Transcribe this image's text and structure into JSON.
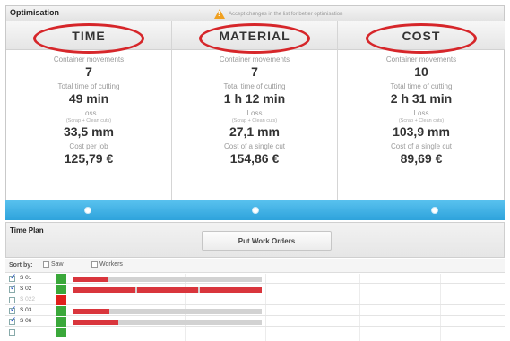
{
  "header": {
    "title": "Optimisation",
    "warning_text": "Accept changes in the list for better optimisation"
  },
  "columns": [
    {
      "title": "TIME",
      "metrics": [
        {
          "label": "Container movements",
          "value": "7"
        },
        {
          "label": "Total time of cutting",
          "value": "49 min"
        },
        {
          "label": "Loss",
          "sublabel": "(Scrap + Clean cuts)",
          "value": "33,5 mm"
        },
        {
          "label": "Cost per job",
          "value": "125,79 €"
        }
      ]
    },
    {
      "title": "MATERIAL",
      "metrics": [
        {
          "label": "Container movements",
          "value": "7"
        },
        {
          "label": "Total time of cutting",
          "value": "1 h 12 min"
        },
        {
          "label": "Loss",
          "sublabel": "(Scrap + Clean cuts)",
          "value": "27,1 mm"
        },
        {
          "label": "Cost of a single cut",
          "value": "154,86 €"
        }
      ]
    },
    {
      "title": "COST",
      "metrics": [
        {
          "label": "Container movements",
          "value": "10"
        },
        {
          "label": "Total time of cutting",
          "value": "2 h 31 min"
        },
        {
          "label": "Loss",
          "sublabel": "(Scrap + Clean cuts)",
          "value": "103,9 mm"
        },
        {
          "label": "Cost of a single cut",
          "value": "89,69 €"
        }
      ]
    }
  ],
  "time_plan": {
    "title": "Time Plan",
    "button_label": "Put Work Orders",
    "sort_by_label": "Sort by:",
    "sort_options": [
      "Saw",
      "Workers"
    ]
  },
  "rows": [
    {
      "label": "S 01",
      "checked": true,
      "status": "green",
      "bars": [
        [
          0.0,
          0.18
        ]
      ],
      "track_end": 1.0
    },
    {
      "label": "S 02",
      "checked": true,
      "status": "green",
      "bars": [
        [
          0.0,
          0.33
        ],
        [
          0.34,
          0.66
        ],
        [
          0.67,
          1.0
        ]
      ],
      "track_end": 1.0
    },
    {
      "label": "S 022",
      "checked": false,
      "status": "red",
      "muted": true,
      "bars": [],
      "track_end": 0.0
    },
    {
      "label": "S 03",
      "checked": true,
      "status": "green",
      "bars": [
        [
          0.0,
          0.19
        ]
      ],
      "track_end": 1.0
    },
    {
      "label": "S 06",
      "checked": true,
      "status": "green",
      "bars": [
        [
          0.0,
          0.24
        ]
      ],
      "track_end": 1.0
    },
    {
      "label": "",
      "checked": false,
      "status": "green",
      "muted": true,
      "bars": [],
      "track_end": 0.0
    }
  ],
  "colors": {
    "accent_blue": "#2ea3dc",
    "highlight_red": "#d6262a",
    "bar_red": "#d9353c",
    "status_green": "#3aa83a",
    "status_red": "#e0201c"
  }
}
